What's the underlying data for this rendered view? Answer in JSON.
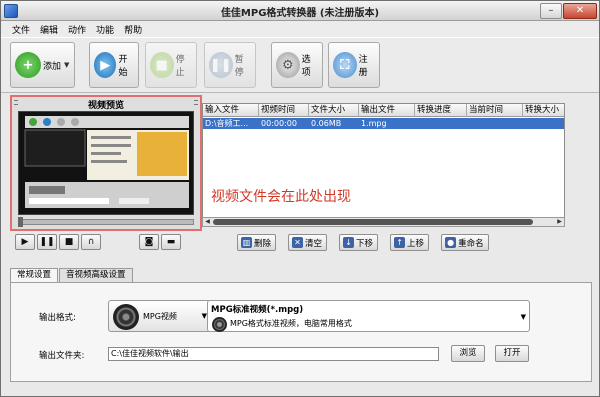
{
  "window": {
    "title": "佳佳MPG格式转换器  (未注册版本)"
  },
  "menu": [
    "文件",
    "编辑",
    "动作",
    "功能",
    "帮助"
  ],
  "toolbar": {
    "add": "添加",
    "start": "开始",
    "stop": "停止",
    "pause": "暂停",
    "options": "选项",
    "register": "注册"
  },
  "preview": {
    "title": "视频预览"
  },
  "file_table": {
    "columns": [
      "输入文件",
      "视频时间",
      "文件大小",
      "输出文件",
      "转换进度",
      "当前时间",
      "转换大小"
    ],
    "rows": [
      [
        "D:\\音频工...",
        "00:00:00",
        "0.06MB",
        "1.mpg",
        "",
        "",
        ""
      ]
    ],
    "hint": "视频文件会在此处出现"
  },
  "actions": {
    "delete": "删除",
    "clear": "清空",
    "down": "下移",
    "up": "上移",
    "rename": "重命名"
  },
  "tabs": [
    "常规设置",
    "音视频高级设置"
  ],
  "settings": {
    "format_label": "输出格式:",
    "format_value": "MPG视频",
    "profile_title": "MPG标准视频(*.mpg)",
    "profile_desc": "MPG格式标准视频，电脑常用格式",
    "folder_label": "输出文件夹:",
    "folder_value": "C:\\佳佳视频软件\\输出",
    "browse": "浏览",
    "open": "打开"
  },
  "colors": {
    "highlight_border": "#e06f6f",
    "selected_row": "#3a72c8",
    "hint_text": "#d03a2a"
  }
}
